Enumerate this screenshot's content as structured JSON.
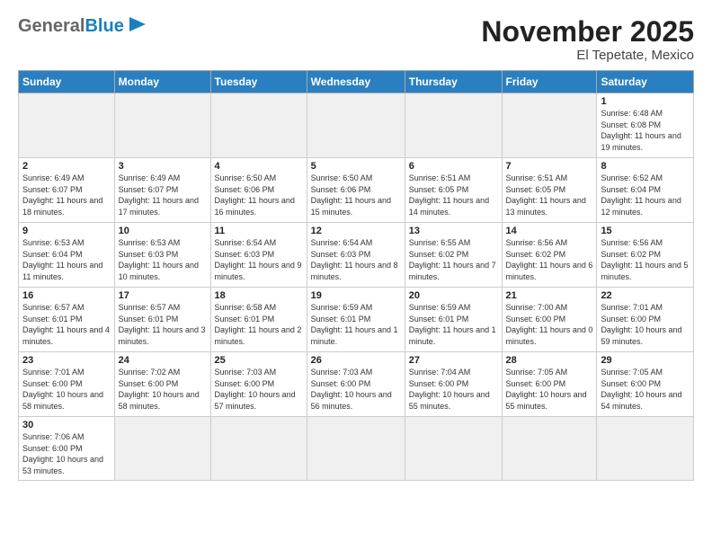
{
  "header": {
    "logo_general": "General",
    "logo_blue": "Blue",
    "month_title": "November 2025",
    "location": "El Tepetate, Mexico"
  },
  "days_of_week": [
    "Sunday",
    "Monday",
    "Tuesday",
    "Wednesday",
    "Thursday",
    "Friday",
    "Saturday"
  ],
  "weeks": [
    [
      {
        "day": "",
        "info": ""
      },
      {
        "day": "",
        "info": ""
      },
      {
        "day": "",
        "info": ""
      },
      {
        "day": "",
        "info": ""
      },
      {
        "day": "",
        "info": ""
      },
      {
        "day": "",
        "info": ""
      },
      {
        "day": "1",
        "info": "Sunrise: 6:48 AM\nSunset: 6:08 PM\nDaylight: 11 hours and 19 minutes."
      }
    ],
    [
      {
        "day": "2",
        "info": "Sunrise: 6:49 AM\nSunset: 6:07 PM\nDaylight: 11 hours and 18 minutes."
      },
      {
        "day": "3",
        "info": "Sunrise: 6:49 AM\nSunset: 6:07 PM\nDaylight: 11 hours and 17 minutes."
      },
      {
        "day": "4",
        "info": "Sunrise: 6:50 AM\nSunset: 6:06 PM\nDaylight: 11 hours and 16 minutes."
      },
      {
        "day": "5",
        "info": "Sunrise: 6:50 AM\nSunset: 6:06 PM\nDaylight: 11 hours and 15 minutes."
      },
      {
        "day": "6",
        "info": "Sunrise: 6:51 AM\nSunset: 6:05 PM\nDaylight: 11 hours and 14 minutes."
      },
      {
        "day": "7",
        "info": "Sunrise: 6:51 AM\nSunset: 6:05 PM\nDaylight: 11 hours and 13 minutes."
      },
      {
        "day": "8",
        "info": "Sunrise: 6:52 AM\nSunset: 6:04 PM\nDaylight: 11 hours and 12 minutes."
      }
    ],
    [
      {
        "day": "9",
        "info": "Sunrise: 6:53 AM\nSunset: 6:04 PM\nDaylight: 11 hours and 11 minutes."
      },
      {
        "day": "10",
        "info": "Sunrise: 6:53 AM\nSunset: 6:03 PM\nDaylight: 11 hours and 10 minutes."
      },
      {
        "day": "11",
        "info": "Sunrise: 6:54 AM\nSunset: 6:03 PM\nDaylight: 11 hours and 9 minutes."
      },
      {
        "day": "12",
        "info": "Sunrise: 6:54 AM\nSunset: 6:03 PM\nDaylight: 11 hours and 8 minutes."
      },
      {
        "day": "13",
        "info": "Sunrise: 6:55 AM\nSunset: 6:02 PM\nDaylight: 11 hours and 7 minutes."
      },
      {
        "day": "14",
        "info": "Sunrise: 6:56 AM\nSunset: 6:02 PM\nDaylight: 11 hours and 6 minutes."
      },
      {
        "day": "15",
        "info": "Sunrise: 6:56 AM\nSunset: 6:02 PM\nDaylight: 11 hours and 5 minutes."
      }
    ],
    [
      {
        "day": "16",
        "info": "Sunrise: 6:57 AM\nSunset: 6:01 PM\nDaylight: 11 hours and 4 minutes."
      },
      {
        "day": "17",
        "info": "Sunrise: 6:57 AM\nSunset: 6:01 PM\nDaylight: 11 hours and 3 minutes."
      },
      {
        "day": "18",
        "info": "Sunrise: 6:58 AM\nSunset: 6:01 PM\nDaylight: 11 hours and 2 minutes."
      },
      {
        "day": "19",
        "info": "Sunrise: 6:59 AM\nSunset: 6:01 PM\nDaylight: 11 hours and 1 minute."
      },
      {
        "day": "20",
        "info": "Sunrise: 6:59 AM\nSunset: 6:01 PM\nDaylight: 11 hours and 1 minute."
      },
      {
        "day": "21",
        "info": "Sunrise: 7:00 AM\nSunset: 6:00 PM\nDaylight: 11 hours and 0 minutes."
      },
      {
        "day": "22",
        "info": "Sunrise: 7:01 AM\nSunset: 6:00 PM\nDaylight: 10 hours and 59 minutes."
      }
    ],
    [
      {
        "day": "23",
        "info": "Sunrise: 7:01 AM\nSunset: 6:00 PM\nDaylight: 10 hours and 58 minutes."
      },
      {
        "day": "24",
        "info": "Sunrise: 7:02 AM\nSunset: 6:00 PM\nDaylight: 10 hours and 58 minutes."
      },
      {
        "day": "25",
        "info": "Sunrise: 7:03 AM\nSunset: 6:00 PM\nDaylight: 10 hours and 57 minutes."
      },
      {
        "day": "26",
        "info": "Sunrise: 7:03 AM\nSunset: 6:00 PM\nDaylight: 10 hours and 56 minutes."
      },
      {
        "day": "27",
        "info": "Sunrise: 7:04 AM\nSunset: 6:00 PM\nDaylight: 10 hours and 55 minutes."
      },
      {
        "day": "28",
        "info": "Sunrise: 7:05 AM\nSunset: 6:00 PM\nDaylight: 10 hours and 55 minutes."
      },
      {
        "day": "29",
        "info": "Sunrise: 7:05 AM\nSunset: 6:00 PM\nDaylight: 10 hours and 54 minutes."
      }
    ],
    [
      {
        "day": "30",
        "info": "Sunrise: 7:06 AM\nSunset: 6:00 PM\nDaylight: 10 hours and 53 minutes."
      },
      {
        "day": "",
        "info": ""
      },
      {
        "day": "",
        "info": ""
      },
      {
        "day": "",
        "info": ""
      },
      {
        "day": "",
        "info": ""
      },
      {
        "day": "",
        "info": ""
      },
      {
        "day": "",
        "info": ""
      }
    ]
  ]
}
